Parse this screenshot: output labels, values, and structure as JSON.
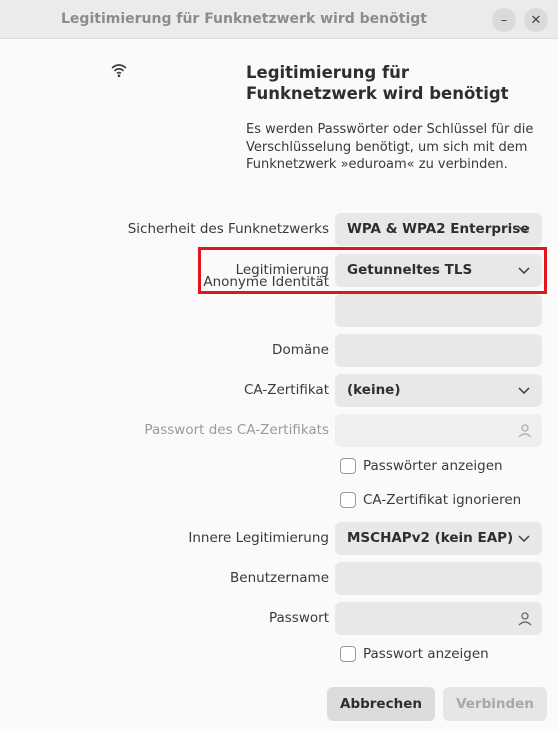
{
  "window": {
    "title": "Legitimierung für Funknetzwerk wird benötigt",
    "minimize_symbol": "–",
    "close_symbol": "✕"
  },
  "header": {
    "icon": "wifi-icon",
    "heading": "Legitimierung für Funknetzwerk wird benötigt",
    "description": "Es werden Passwörter oder Schlüssel für die Verschlüsselung benötigt, um sich mit dem Funknetzwerk »eduroam« zu verbinden."
  },
  "form": {
    "security_label": "Sicherheit des Funknetzwerks",
    "security_value": "WPA & WPA2 Enterprise",
    "auth_label": "Legitimierung",
    "auth_value": "Getunneltes TLS",
    "anon_identity_label": "Anonyme Identität",
    "anon_identity_value": "",
    "domain_label": "Domäne",
    "domain_value": "",
    "ca_cert_label": "CA-Zertifikat",
    "ca_cert_value": "(keine)",
    "ca_password_label": "Passwort des CA-Zertifikats",
    "ca_password_value": "",
    "show_passwords_label": "Passwörter anzeigen",
    "ignore_ca_label": "CA-Zertifikat ignorieren",
    "inner_auth_label": "Innere Legitimierung",
    "inner_auth_value": "MSCHAPv2 (kein EAP)",
    "username_label": "Benutzername",
    "username_value": "",
    "password_label": "Passwort",
    "password_value": "",
    "show_password_label": "Passwort anzeigen"
  },
  "buttons": {
    "cancel": "Abbrechen",
    "connect": "Verbinden"
  },
  "colors": {
    "highlight": "#e0161e"
  }
}
